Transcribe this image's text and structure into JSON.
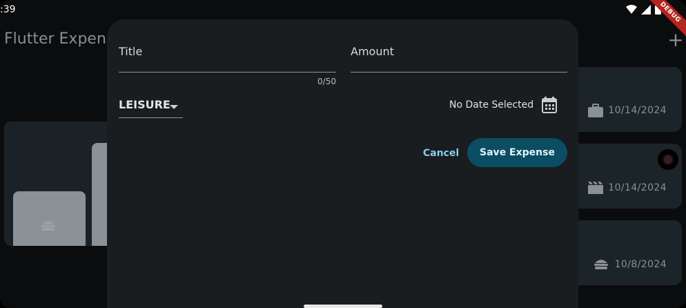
{
  "status_bar": {
    "time": ":39"
  },
  "debug_banner": "DEBUG",
  "app": {
    "title": "Flutter Expens",
    "expenses": [
      {
        "date": "10/14/2024",
        "icon": "work-icon"
      },
      {
        "date": "10/14/2024",
        "icon": "movie-icon"
      },
      {
        "date": "10/8/2024",
        "icon": "fastfood-icon"
      }
    ]
  },
  "sheet": {
    "title_label": "Title",
    "title_value": "",
    "title_counter": "0/50",
    "amount_label": "Amount",
    "amount_value": "",
    "category": "LEISURE",
    "date_text": "No Date Selected",
    "cancel_label": "Cancel",
    "save_label": "Save Expense"
  },
  "colors": {
    "sheet_bg": "#191d20",
    "primary_button": "#0b4d63",
    "text_button": "#85cfe6"
  }
}
